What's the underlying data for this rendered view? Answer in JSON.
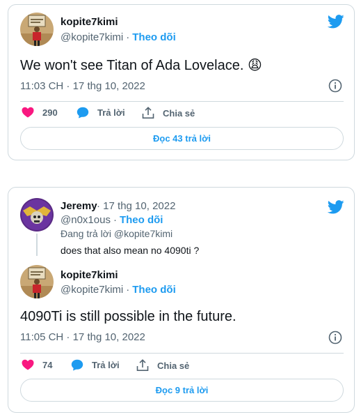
{
  "colors": {
    "accent": "#1d9bf0",
    "like": "#f91880",
    "muted": "#536471",
    "border": "#cfd9de"
  },
  "tweet1": {
    "author_name": "kopite7kimi",
    "author_handle": "@kopite7kimi",
    "follow_label": "Theo dõi",
    "text": "We won't see Titan of Ada Lovelace. 😩",
    "timestamp": "11:03 CH · 17 thg 10, 2022",
    "likes": "290",
    "reply_label": "Trả lời",
    "share_label": "Chia sẻ",
    "read_replies_label": "Đọc 43 trả lời",
    "icons": {
      "bird": "twitter-bird-icon",
      "info": "info-icon",
      "heart": "heart-icon",
      "reply": "reply-bubble-icon",
      "share": "share-icon"
    }
  },
  "tweet2": {
    "parent": {
      "author_name": "Jeremy",
      "date": "17 thg 10, 2022",
      "author_handle": "@n0x1ous",
      "follow_label": "Theo dõi",
      "replying_to": "Đang trả lời @kopite7kimi",
      "text": "does that also mean no 4090ti ?"
    },
    "reply": {
      "author_name": "kopite7kimi",
      "author_handle": "@kopite7kimi",
      "follow_label": "Theo dõi",
      "text": "4090Ti is still possible in the future.",
      "timestamp": "11:05 CH · 17 thg 10, 2022",
      "likes": "74",
      "reply_label": "Trả lời",
      "share_label": "Chia sẻ",
      "read_replies_label": "Đọc 9 trả lời"
    }
  }
}
